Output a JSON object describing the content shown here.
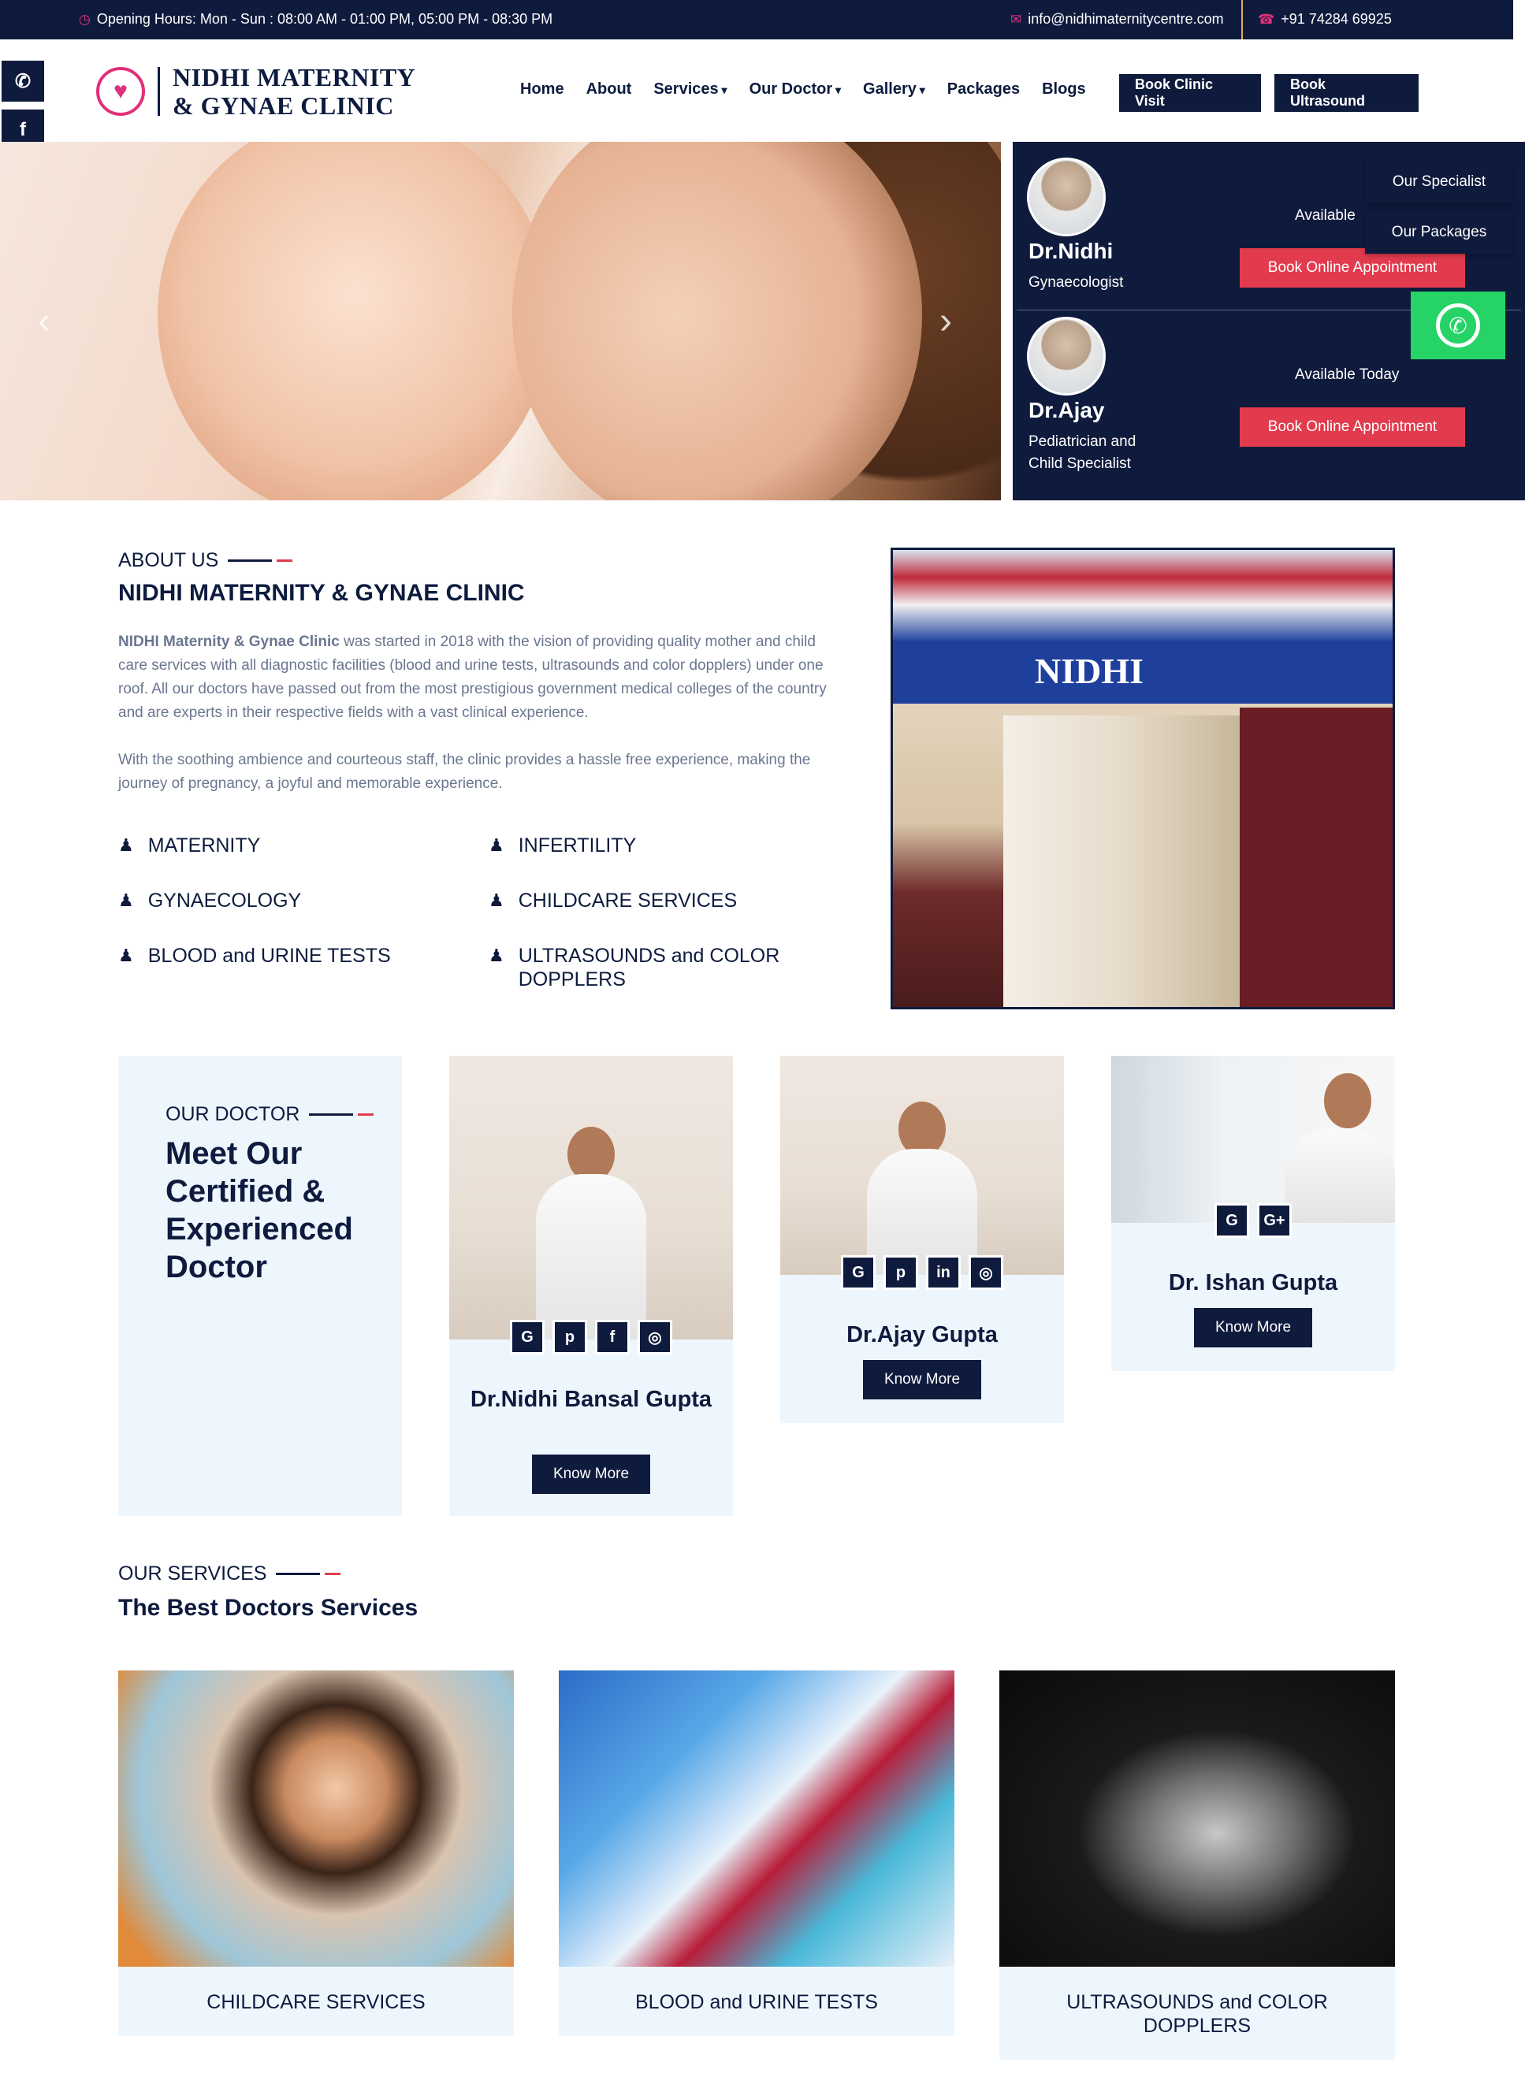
{
  "topbar": {
    "hours": "Opening Hours: Mon - Sun : 08:00 AM - 01:00 PM, 05:00 PM - 08:30 PM",
    "email": "info@nidhimaternitycentre.com",
    "phone": "+91 74284 69925"
  },
  "social": [
    "whatsapp-icon",
    "facebook-icon",
    "instagram-icon"
  ],
  "logo": {
    "line1": "NIDHI MATERNITY",
    "line2": "& GYNAE CLINIC"
  },
  "nav": {
    "items": [
      "Home",
      "About",
      "Services",
      "Our Doctor",
      "Gallery",
      "Packages",
      "Blogs"
    ],
    "book_clinic": "Book Clinic Visit",
    "book_ultrasound": "Book Ultrasound"
  },
  "doctors_panel": [
    {
      "name": "Dr.Nidhi",
      "role": "Gynaecologist",
      "available": "Available",
      "button": "Book Online Appointment"
    },
    {
      "name": "Dr.Ajay",
      "role_line1": "Pediatrician and",
      "role_line2": "Child Specialist",
      "available": "Available Today",
      "button": "Book Online Appointment"
    }
  ],
  "float_menu": [
    "Our Specialist",
    "Our Packages"
  ],
  "about": {
    "label": "ABOUT US",
    "title": "NIDHI MATERNITY & GYNAE CLINIC",
    "p1_strong": "NIDHI Maternity & Gynae Clinic",
    "p1": " was started in 2018 with the vision of providing quality mother and child care services with all diagnostic facilities (blood and urine tests, ultrasounds and color dopplers) under one roof. All our doctors have passed out from the most prestigious government medical colleges of the country and are experts in their respective fields with a vast clinical experience.",
    "p2": "With the soothing ambience and courteous staff, the clinic provides a hassle free experience, making the journey of pregnancy, a joyful and memorable experience.",
    "services": [
      "MATERNITY",
      "INFERTILITY",
      "GYNAECOLOGY",
      "CHILDCARE SERVICES",
      "BLOOD and URINE TESTS",
      "ULTRASOUNDS and COLOR DOPPLERS"
    ],
    "photo_sign": "NIDHI"
  },
  "our_doctor": {
    "label": "OUR DOCTOR",
    "heading": "Meet Our Certified & Experienced Doctor",
    "cards": [
      {
        "name": "Dr.Nidhi Bansal Gupta",
        "icons": [
          "G",
          "p",
          "f",
          "ig"
        ],
        "button": "Know More"
      },
      {
        "name": "Dr.Ajay Gupta",
        "icons": [
          "G",
          "p",
          "in",
          "ig"
        ],
        "button": "Know More"
      },
      {
        "name": "Dr. Ishan Gupta",
        "icons": [
          "G",
          "G+"
        ],
        "button": "Know More"
      }
    ]
  },
  "services": {
    "label": "OUR SERVICES",
    "title": "The Best Doctors Services",
    "cards": [
      "CHILDCARE SERVICES",
      "BLOOD and URINE TESTS",
      "ULTRASOUNDS and COLOR DOPPLERS"
    ]
  }
}
